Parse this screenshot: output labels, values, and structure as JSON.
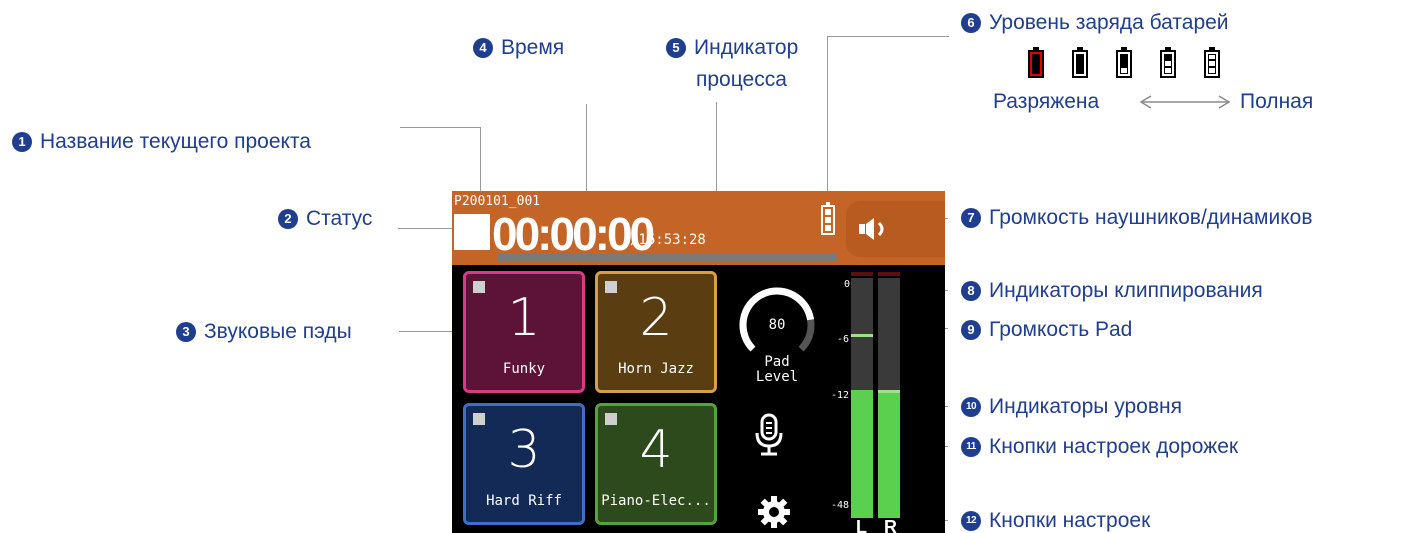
{
  "callouts": {
    "c1": {
      "num": "1",
      "text": "Название текущего проекта"
    },
    "c2": {
      "num": "2",
      "text": "Статус"
    },
    "c3": {
      "num": "3",
      "text": "Звуковые пэды"
    },
    "c4": {
      "num": "4",
      "text": "Время"
    },
    "c5": {
      "num": "5",
      "line1": "Индикатор",
      "line2": "процесса"
    },
    "c6": {
      "num": "6",
      "text": "Уровень заряда батарей",
      "empty": "Разряжена",
      "full": "Полная"
    },
    "c7": {
      "num": "7",
      "text": "Громкость наушников/динамиков"
    },
    "c8": {
      "num": "8",
      "text": "Индикаторы клиппирования"
    },
    "c9": {
      "num": "9",
      "text": "Громкость Pad"
    },
    "c10": {
      "num": "10",
      "text": "Индикаторы уровня"
    },
    "c11": {
      "num": "11",
      "text": "Кнопки настроек дорожек"
    },
    "c12": {
      "num": "12",
      "text": "Кнопки настроек"
    }
  },
  "screen": {
    "project_name": "P200101_001",
    "time": "00:00:00",
    "total_time": "/16:53:28",
    "progress": 0,
    "battery_level_segments": 3,
    "pads": [
      {
        "number": "1",
        "name": "Funky"
      },
      {
        "number": "2",
        "name": "Horn Jazz"
      },
      {
        "number": "3",
        "name": "Hard Riff"
      },
      {
        "number": "4",
        "name": "Piano-Elec..."
      }
    ],
    "pad_level": {
      "value": "80",
      "label_line1": "Pad",
      "label_line2": "Level",
      "fraction": 0.8
    },
    "meter": {
      "scale": [
        "0",
        "-6",
        "-12",
        "-48"
      ],
      "left_label": "L",
      "right_label": "R",
      "left_level_db": -12,
      "right_level_db": -13,
      "left_peak_db": -6,
      "right_peak_db": -12
    }
  },
  "colors": {
    "callout_text": "#1f3e8f",
    "topbar": "#c46426",
    "battery_empty": "#e00000",
    "meter_green": "#5bd04e"
  },
  "icons": [
    "stop-icon",
    "battery-icon",
    "speaker-icon",
    "microphone-icon",
    "gear-icon",
    "pad-level-knob-icon"
  ]
}
